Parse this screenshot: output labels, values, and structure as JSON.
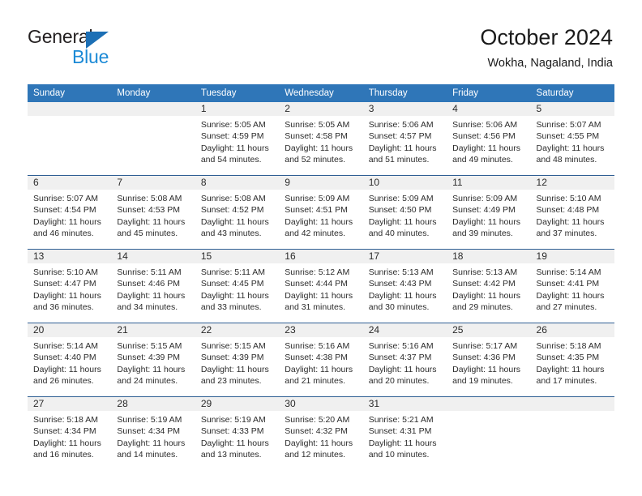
{
  "brand": {
    "name_part1": "General",
    "name_part2": "Blue",
    "triangle_color": "#1c6fb5",
    "blue_text_color": "#1c8ad6"
  },
  "header": {
    "title": "October 2024",
    "subtitle": "Wokha, Nagaland, India"
  },
  "theme": {
    "header_blue": "#2f76b8",
    "row_divider": "#2f5f94",
    "daynum_band": "#f0f0f0"
  },
  "weekdays": [
    "Sunday",
    "Monday",
    "Tuesday",
    "Wednesday",
    "Thursday",
    "Friday",
    "Saturday"
  ],
  "weeks": [
    [
      {
        "day": "",
        "lines": []
      },
      {
        "day": "",
        "lines": []
      },
      {
        "day": "1",
        "lines": [
          "Sunrise: 5:05 AM",
          "Sunset: 4:59 PM",
          "Daylight: 11 hours",
          "and 54 minutes."
        ]
      },
      {
        "day": "2",
        "lines": [
          "Sunrise: 5:05 AM",
          "Sunset: 4:58 PM",
          "Daylight: 11 hours",
          "and 52 minutes."
        ]
      },
      {
        "day": "3",
        "lines": [
          "Sunrise: 5:06 AM",
          "Sunset: 4:57 PM",
          "Daylight: 11 hours",
          "and 51 minutes."
        ]
      },
      {
        "day": "4",
        "lines": [
          "Sunrise: 5:06 AM",
          "Sunset: 4:56 PM",
          "Daylight: 11 hours",
          "and 49 minutes."
        ]
      },
      {
        "day": "5",
        "lines": [
          "Sunrise: 5:07 AM",
          "Sunset: 4:55 PM",
          "Daylight: 11 hours",
          "and 48 minutes."
        ]
      }
    ],
    [
      {
        "day": "6",
        "lines": [
          "Sunrise: 5:07 AM",
          "Sunset: 4:54 PM",
          "Daylight: 11 hours",
          "and 46 minutes."
        ]
      },
      {
        "day": "7",
        "lines": [
          "Sunrise: 5:08 AM",
          "Sunset: 4:53 PM",
          "Daylight: 11 hours",
          "and 45 minutes."
        ]
      },
      {
        "day": "8",
        "lines": [
          "Sunrise: 5:08 AM",
          "Sunset: 4:52 PM",
          "Daylight: 11 hours",
          "and 43 minutes."
        ]
      },
      {
        "day": "9",
        "lines": [
          "Sunrise: 5:09 AM",
          "Sunset: 4:51 PM",
          "Daylight: 11 hours",
          "and 42 minutes."
        ]
      },
      {
        "day": "10",
        "lines": [
          "Sunrise: 5:09 AM",
          "Sunset: 4:50 PM",
          "Daylight: 11 hours",
          "and 40 minutes."
        ]
      },
      {
        "day": "11",
        "lines": [
          "Sunrise: 5:09 AM",
          "Sunset: 4:49 PM",
          "Daylight: 11 hours",
          "and 39 minutes."
        ]
      },
      {
        "day": "12",
        "lines": [
          "Sunrise: 5:10 AM",
          "Sunset: 4:48 PM",
          "Daylight: 11 hours",
          "and 37 minutes."
        ]
      }
    ],
    [
      {
        "day": "13",
        "lines": [
          "Sunrise: 5:10 AM",
          "Sunset: 4:47 PM",
          "Daylight: 11 hours",
          "and 36 minutes."
        ]
      },
      {
        "day": "14",
        "lines": [
          "Sunrise: 5:11 AM",
          "Sunset: 4:46 PM",
          "Daylight: 11 hours",
          "and 34 minutes."
        ]
      },
      {
        "day": "15",
        "lines": [
          "Sunrise: 5:11 AM",
          "Sunset: 4:45 PM",
          "Daylight: 11 hours",
          "and 33 minutes."
        ]
      },
      {
        "day": "16",
        "lines": [
          "Sunrise: 5:12 AM",
          "Sunset: 4:44 PM",
          "Daylight: 11 hours",
          "and 31 minutes."
        ]
      },
      {
        "day": "17",
        "lines": [
          "Sunrise: 5:13 AM",
          "Sunset: 4:43 PM",
          "Daylight: 11 hours",
          "and 30 minutes."
        ]
      },
      {
        "day": "18",
        "lines": [
          "Sunrise: 5:13 AM",
          "Sunset: 4:42 PM",
          "Daylight: 11 hours",
          "and 29 minutes."
        ]
      },
      {
        "day": "19",
        "lines": [
          "Sunrise: 5:14 AM",
          "Sunset: 4:41 PM",
          "Daylight: 11 hours",
          "and 27 minutes."
        ]
      }
    ],
    [
      {
        "day": "20",
        "lines": [
          "Sunrise: 5:14 AM",
          "Sunset: 4:40 PM",
          "Daylight: 11 hours",
          "and 26 minutes."
        ]
      },
      {
        "day": "21",
        "lines": [
          "Sunrise: 5:15 AM",
          "Sunset: 4:39 PM",
          "Daylight: 11 hours",
          "and 24 minutes."
        ]
      },
      {
        "day": "22",
        "lines": [
          "Sunrise: 5:15 AM",
          "Sunset: 4:39 PM",
          "Daylight: 11 hours",
          "and 23 minutes."
        ]
      },
      {
        "day": "23",
        "lines": [
          "Sunrise: 5:16 AM",
          "Sunset: 4:38 PM",
          "Daylight: 11 hours",
          "and 21 minutes."
        ]
      },
      {
        "day": "24",
        "lines": [
          "Sunrise: 5:16 AM",
          "Sunset: 4:37 PM",
          "Daylight: 11 hours",
          "and 20 minutes."
        ]
      },
      {
        "day": "25",
        "lines": [
          "Sunrise: 5:17 AM",
          "Sunset: 4:36 PM",
          "Daylight: 11 hours",
          "and 19 minutes."
        ]
      },
      {
        "day": "26",
        "lines": [
          "Sunrise: 5:18 AM",
          "Sunset: 4:35 PM",
          "Daylight: 11 hours",
          "and 17 minutes."
        ]
      }
    ],
    [
      {
        "day": "27",
        "lines": [
          "Sunrise: 5:18 AM",
          "Sunset: 4:34 PM",
          "Daylight: 11 hours",
          "and 16 minutes."
        ]
      },
      {
        "day": "28",
        "lines": [
          "Sunrise: 5:19 AM",
          "Sunset: 4:34 PM",
          "Daylight: 11 hours",
          "and 14 minutes."
        ]
      },
      {
        "day": "29",
        "lines": [
          "Sunrise: 5:19 AM",
          "Sunset: 4:33 PM",
          "Daylight: 11 hours",
          "and 13 minutes."
        ]
      },
      {
        "day": "30",
        "lines": [
          "Sunrise: 5:20 AM",
          "Sunset: 4:32 PM",
          "Daylight: 11 hours",
          "and 12 minutes."
        ]
      },
      {
        "day": "31",
        "lines": [
          "Sunrise: 5:21 AM",
          "Sunset: 4:31 PM",
          "Daylight: 11 hours",
          "and 10 minutes."
        ]
      },
      {
        "day": "",
        "lines": []
      },
      {
        "day": "",
        "lines": []
      }
    ]
  ]
}
